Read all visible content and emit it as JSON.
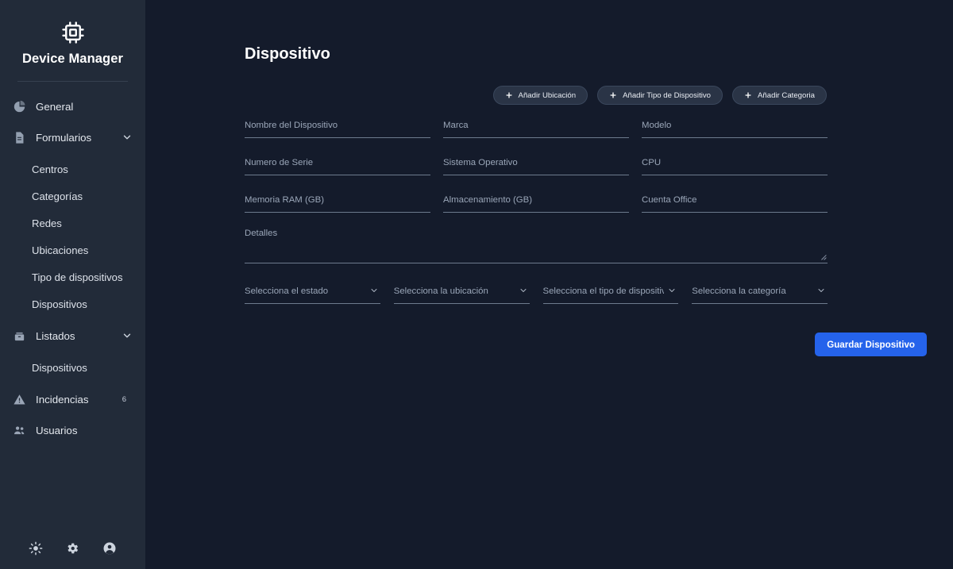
{
  "sidebar": {
    "brand": {
      "title": "Device Manager",
      "icon": "cpu-chip-icon"
    },
    "items": [
      {
        "label": "General",
        "icon": "pie-chart-icon",
        "level": "top",
        "chevron": false,
        "badge": null
      },
      {
        "label": "Formularios",
        "icon": "document-form-icon",
        "level": "top",
        "chevron": true,
        "badge": null
      },
      {
        "label": "Centros",
        "icon": null,
        "level": "sub",
        "chevron": false,
        "badge": null
      },
      {
        "label": "Categorías",
        "icon": null,
        "level": "sub",
        "chevron": false,
        "badge": null
      },
      {
        "label": "Redes",
        "icon": null,
        "level": "sub",
        "chevron": false,
        "badge": null
      },
      {
        "label": "Ubicaciones",
        "icon": null,
        "level": "sub",
        "chevron": false,
        "badge": null
      },
      {
        "label": "Tipo de dispositivos",
        "icon": null,
        "level": "sub",
        "chevron": false,
        "badge": null
      },
      {
        "label": "Dispositivos",
        "icon": null,
        "level": "sub",
        "chevron": false,
        "badge": null
      },
      {
        "label": "Listados",
        "icon": "archive-box-icon",
        "level": "top",
        "chevron": true,
        "badge": null
      },
      {
        "label": "Dispositivos",
        "icon": null,
        "level": "sub",
        "chevron": false,
        "badge": null
      },
      {
        "label": "Incidencias",
        "icon": "warning-triangle-icon",
        "level": "top",
        "chevron": false,
        "badge": "6"
      },
      {
        "label": "Usuarios",
        "icon": "users-icon",
        "level": "top",
        "chevron": false,
        "badge": null
      }
    ],
    "bottom_icons": [
      {
        "name": "brightness-sun-icon"
      },
      {
        "name": "settings-gear-icon"
      },
      {
        "name": "user-account-icon"
      }
    ]
  },
  "main": {
    "page_title": "Dispositivo",
    "add_buttons": [
      {
        "label": "Añadir Ubicación"
      },
      {
        "label": "Añadir Tipo de Dispositivo"
      },
      {
        "label": "Añadir Categoria"
      }
    ],
    "fields": {
      "nombre_dispositivo": {
        "placeholder": "Nombre del Dispositivo",
        "value": ""
      },
      "marca": {
        "placeholder": "Marca",
        "value": ""
      },
      "modelo": {
        "placeholder": "Modelo",
        "value": ""
      },
      "numero_serie": {
        "placeholder": "Numero de Serie",
        "value": ""
      },
      "sistema_operativo": {
        "placeholder": "Sistema Operativo",
        "value": ""
      },
      "cpu": {
        "placeholder": "CPU",
        "value": ""
      },
      "memoria_ram": {
        "placeholder": "Memoria RAM (GB)",
        "value": ""
      },
      "almacenamiento": {
        "placeholder": "Almacenamiento (GB)",
        "value": ""
      },
      "cuenta_office": {
        "placeholder": "Cuenta Office",
        "value": ""
      },
      "detalles": {
        "placeholder": "Detalles",
        "value": ""
      }
    },
    "selects": [
      {
        "placeholder": "Selecciona el estado"
      },
      {
        "placeholder": "Selecciona la ubicación"
      },
      {
        "placeholder": "Selecciona el tipo de dispositivo"
      },
      {
        "placeholder": "Selecciona la categoría"
      }
    ],
    "save_label": "Guardar Dispositivo"
  },
  "colors": {
    "sidebar_bg": "#222b39",
    "main_bg": "#141b2b",
    "accent": "#2563eb",
    "add_button_bg": "#2a3446",
    "placeholder": "#9aa6b8",
    "underline": "#6d7a8d"
  }
}
